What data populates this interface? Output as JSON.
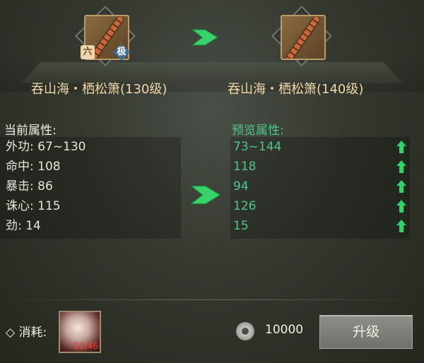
{
  "items": {
    "current": {
      "name": "吞山海・栖松箫(130级)",
      "badge_tier": "六",
      "badge_quality": "极"
    },
    "preview": {
      "name": "吞山海・栖松箫(140级)"
    }
  },
  "stats": {
    "current_title": "当前属性:",
    "preview_title": "预览属性:",
    "rows": [
      {
        "label": "外功:",
        "current": "67~130",
        "preview": "73~144"
      },
      {
        "label": "命中:",
        "current": "108",
        "preview": "118"
      },
      {
        "label": "暴击:",
        "current": "86",
        "preview": "94"
      },
      {
        "label": "诛心:",
        "current": "115",
        "preview": "126"
      },
      {
        "label": "劲:",
        "current": "14",
        "preview": "15"
      }
    ]
  },
  "cost": {
    "label": "消耗:",
    "material_count": "11/46",
    "coin_amount": "10000"
  },
  "actions": {
    "upgrade_label": "升级"
  },
  "colors": {
    "preview_value": "#4fc48d",
    "up_arrow": "#2fd46a",
    "item_name": "#f0d9a8"
  }
}
